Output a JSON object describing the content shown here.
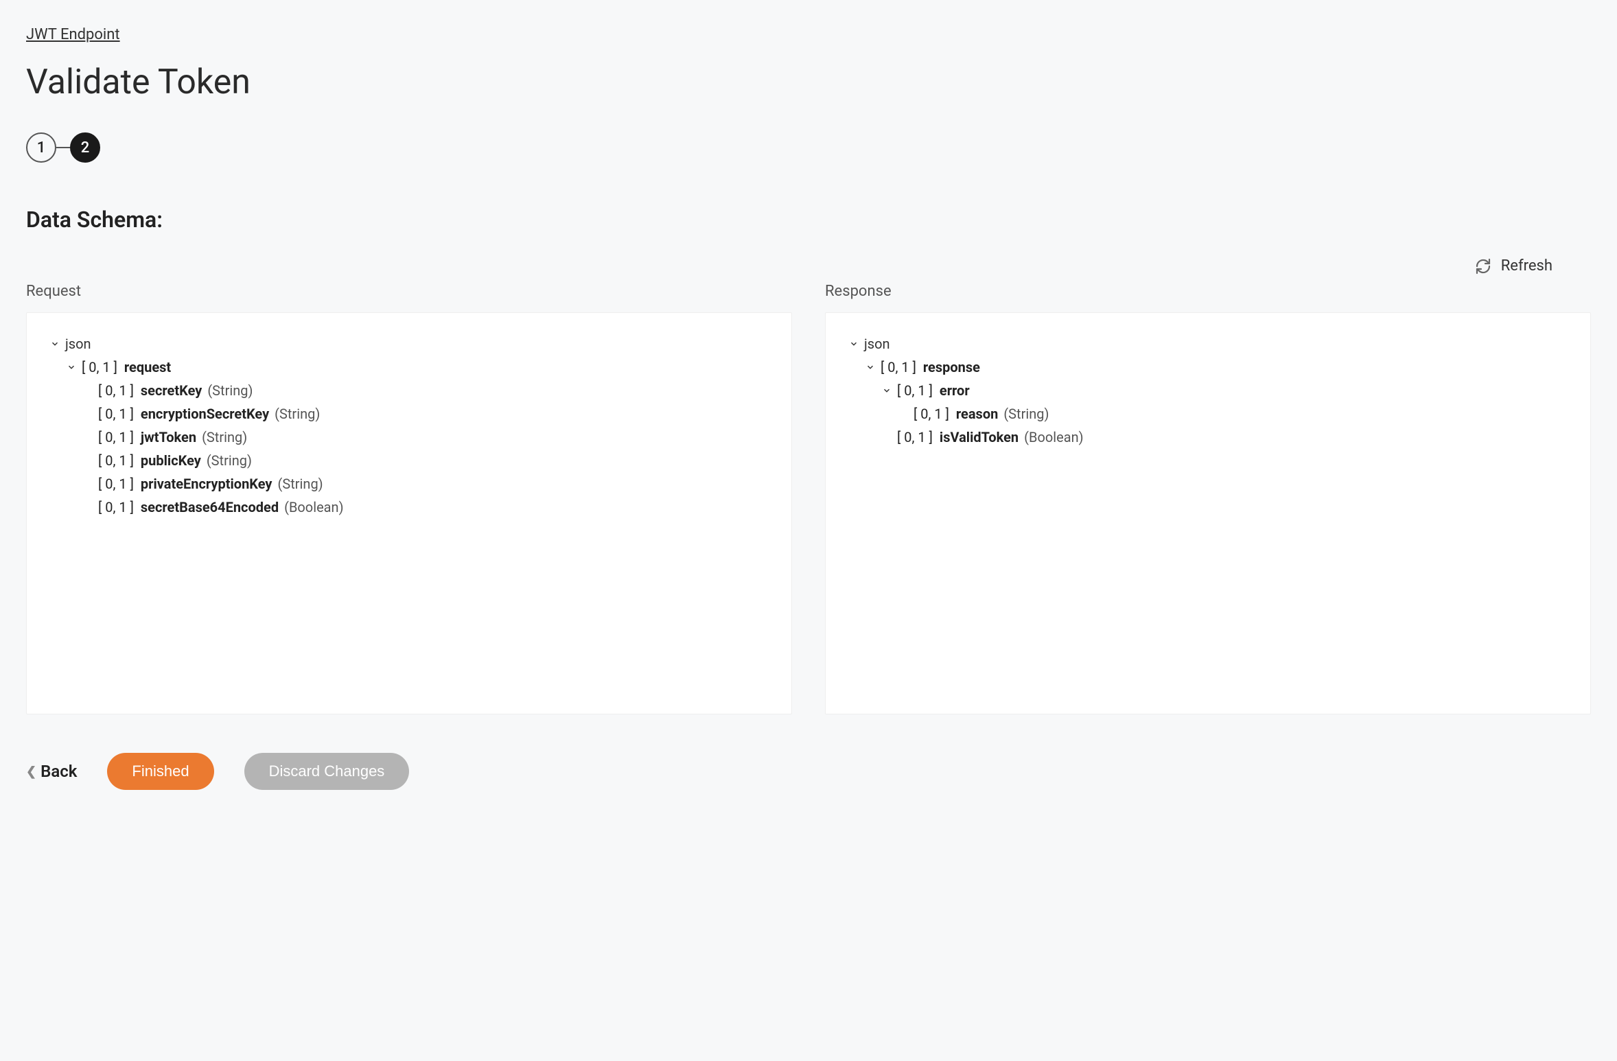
{
  "breadcrumb": "JWT Endpoint",
  "pageTitle": "Validate Token",
  "stepper": {
    "step1": "1",
    "step2": "2"
  },
  "sectionHeading": "Data Schema:",
  "refreshLabel": "Refresh",
  "panelLabels": {
    "request": "Request",
    "response": "Response"
  },
  "rootLabel": "json",
  "requestTree": {
    "root": {
      "card": "[ 0, 1 ]",
      "name": "request"
    },
    "fields": [
      {
        "card": "[ 0, 1 ]",
        "name": "secretKey",
        "type": "(String)"
      },
      {
        "card": "[ 0, 1 ]",
        "name": "encryptionSecretKey",
        "type": "(String)"
      },
      {
        "card": "[ 0, 1 ]",
        "name": "jwtToken",
        "type": "(String)"
      },
      {
        "card": "[ 0, 1 ]",
        "name": "publicKey",
        "type": "(String)"
      },
      {
        "card": "[ 0, 1 ]",
        "name": "privateEncryptionKey",
        "type": "(String)"
      },
      {
        "card": "[ 0, 1 ]",
        "name": "secretBase64Encoded",
        "type": "(Boolean)"
      }
    ]
  },
  "responseTree": {
    "root": {
      "card": "[ 0, 1 ]",
      "name": "response"
    },
    "error": {
      "card": "[ 0, 1 ]",
      "name": "error"
    },
    "errorFields": [
      {
        "card": "[ 0, 1 ]",
        "name": "reason",
        "type": "(String)"
      }
    ],
    "fields": [
      {
        "card": "[ 0, 1 ]",
        "name": "isValidToken",
        "type": "(Boolean)"
      }
    ]
  },
  "buttons": {
    "back": "Back",
    "finished": "Finished",
    "discard": "Discard Changes"
  }
}
